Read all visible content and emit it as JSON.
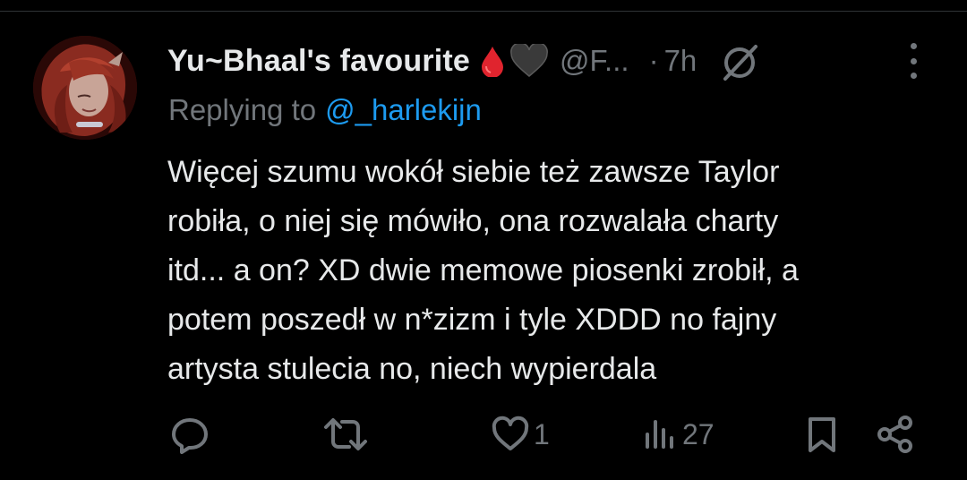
{
  "tweet": {
    "author": {
      "display_name": "Yu~Bhaal's favourite",
      "emoji": [
        "drop-of-blood",
        "black-heart"
      ],
      "handle": "@F...",
      "separator": "·",
      "time": "7h"
    },
    "reply": {
      "prefix": "Replying to",
      "mention": "@_harlekijn"
    },
    "text_lines": [
      "Więcej szumu wokół siebie też zawsze Taylor",
      "robiła, o niej się mówiło, ona rozwalała charty",
      "itd... a on? XD dwie memowe piosenki zrobił, a",
      "potem poszedł w n*zizm i tyle XDDD no fajny",
      "artysta stulecia no, niech wypierdala"
    ],
    "actions": {
      "reply_icon": "reply-icon",
      "retweet_icon": "retweet-icon",
      "like_icon": "heart-icon",
      "like_count": "1",
      "views_icon": "views-icon",
      "views_count": "27",
      "bookmark_icon": "bookmark-icon",
      "share_icon": "share-icon"
    }
  },
  "colors": {
    "background": "#000000",
    "text": "#e7e9ea",
    "muted": "#71767b",
    "link": "#1d9bf0",
    "blood": "#e0242e"
  }
}
